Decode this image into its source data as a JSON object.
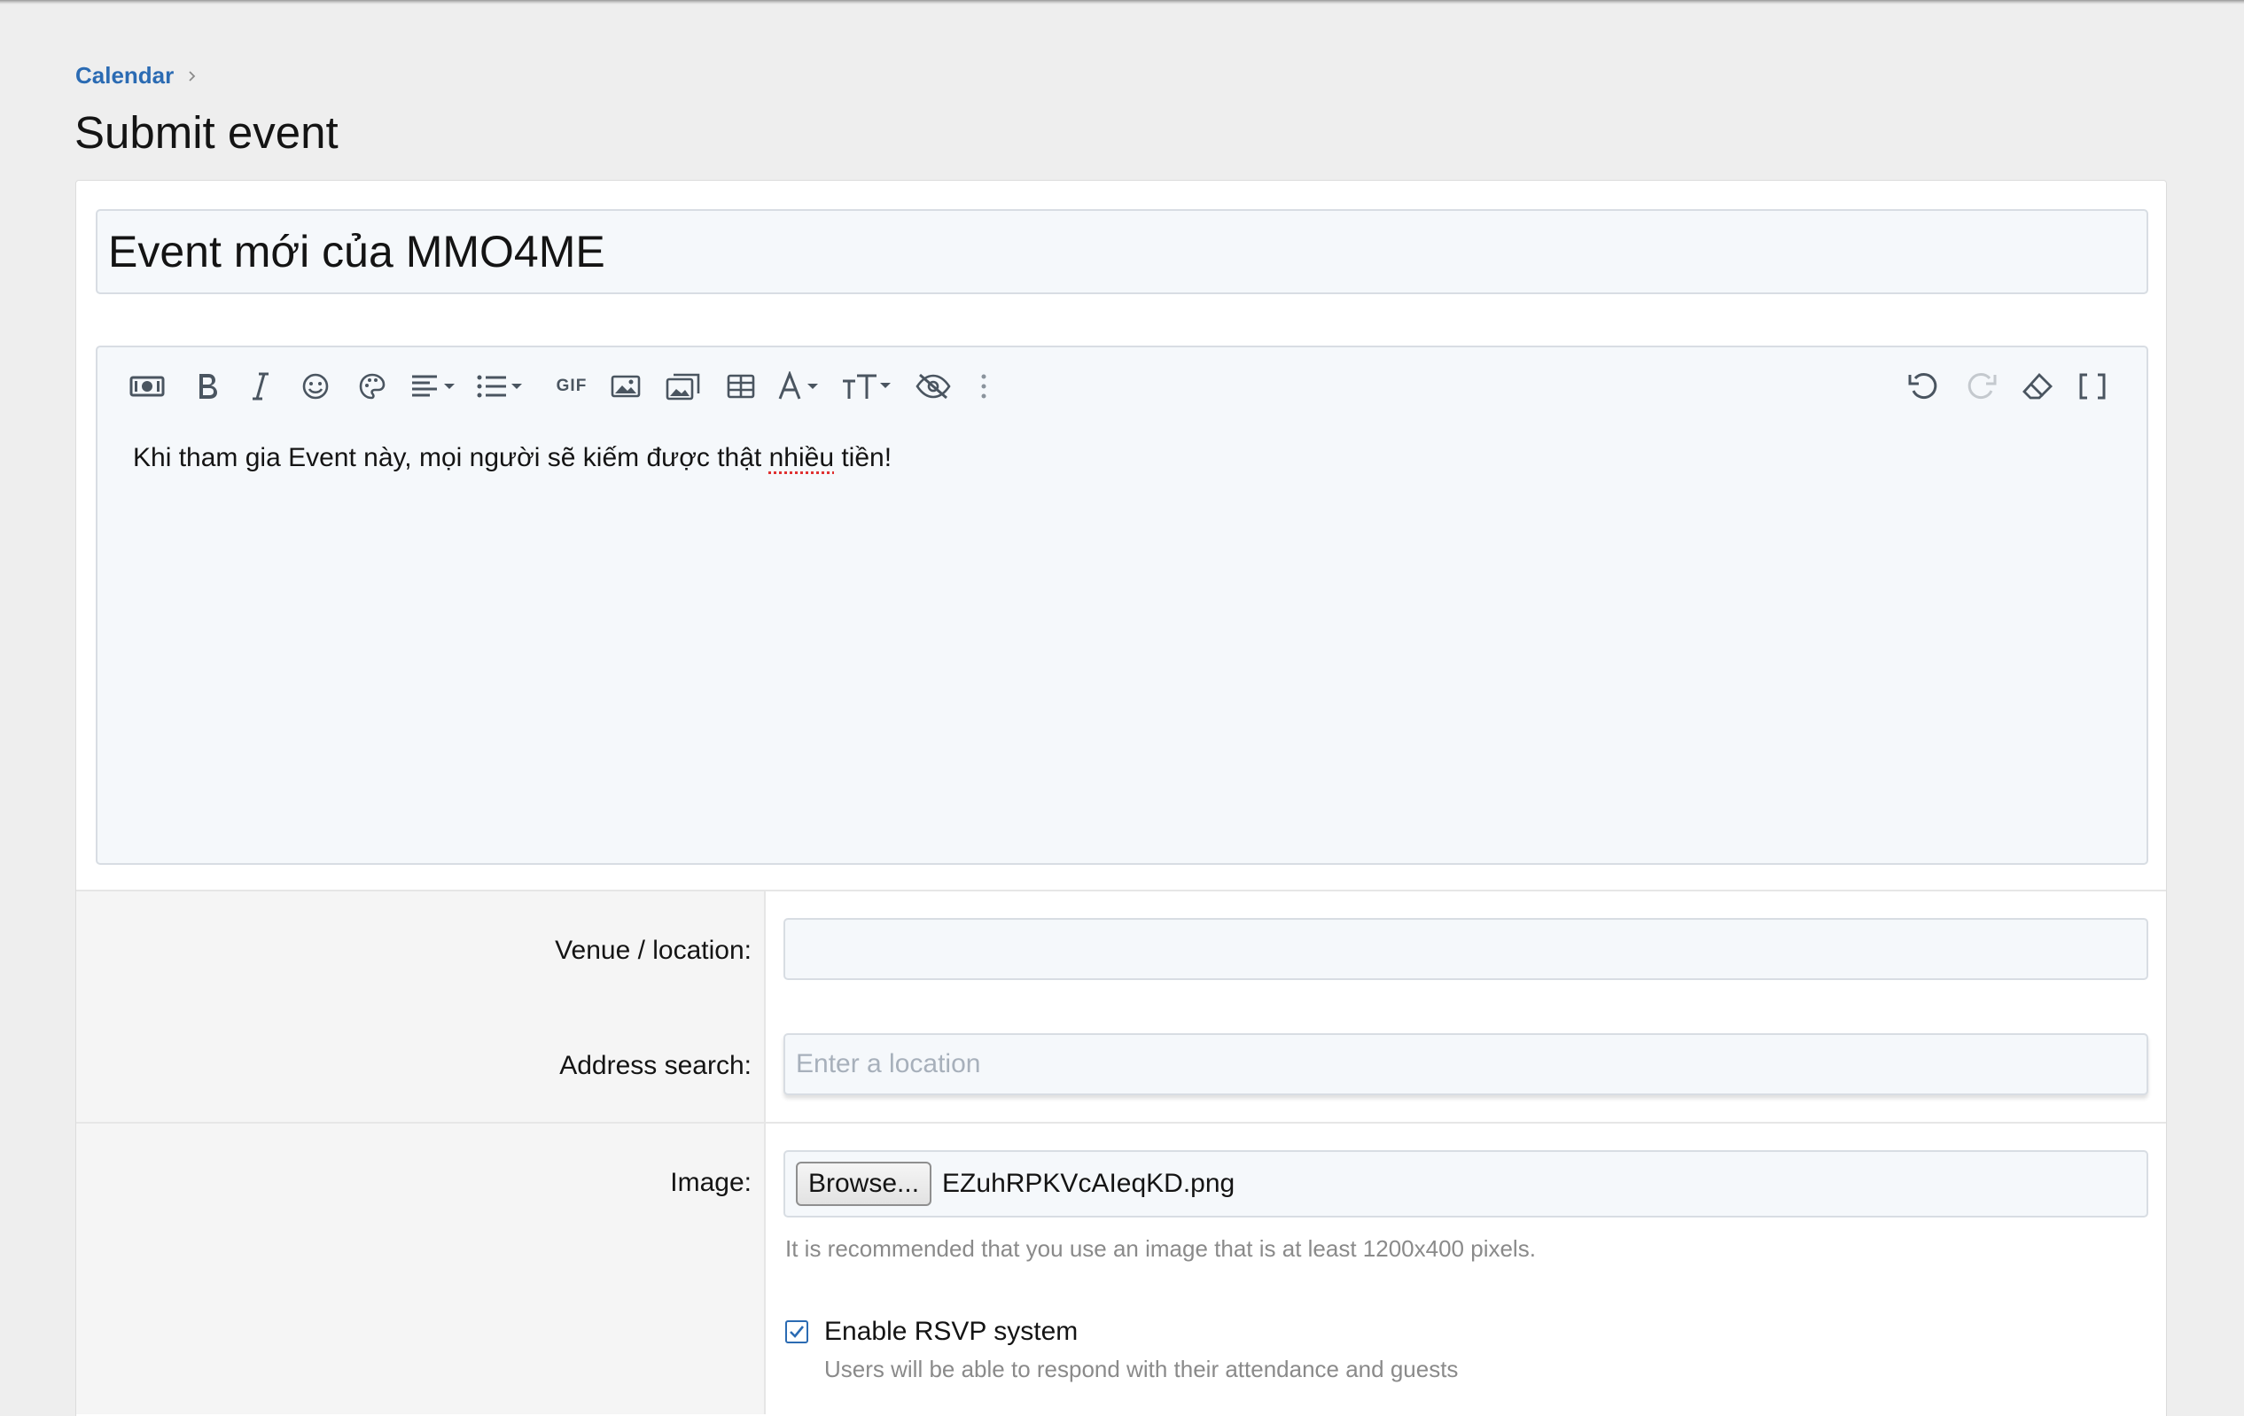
{
  "breadcrumb": {
    "parent": "Calendar"
  },
  "page_title": "Submit event",
  "event_title": {
    "value": "Event mới của MMO4ME"
  },
  "editor": {
    "toolbar_icons": [
      "money-icon",
      "bold-icon",
      "italic-icon",
      "smiley-icon",
      "palette-icon",
      "align-icon",
      "list-icon",
      "gif-icon",
      "image-icon",
      "media-icon",
      "table-icon",
      "font-icon",
      "text-size-icon",
      "hide-icon",
      "more-icon",
      "undo-icon",
      "redo-icon",
      "eraser-icon",
      "brackets-icon"
    ],
    "gif_label": "GIF",
    "content_before": "Khi tham gia Event này, mọi người sẽ kiếm được thật ",
    "content_misspelled": "nhiều",
    "content_after": " tiền!"
  },
  "venue": {
    "label": "Venue / location:",
    "value": ""
  },
  "address": {
    "label": "Address search:",
    "placeholder": "Enter a location"
  },
  "image": {
    "label": "Image:",
    "browse_label": "Browse...",
    "file_name": "EZuhRPKVcAIeqKD.png",
    "hint": "It is recommended that you use an image that is at least 1200x400 pixels."
  },
  "rsvp": {
    "checked": true,
    "label": "Enable RSVP system",
    "description": "Users will be able to respond with their attendance and guests"
  },
  "colors": {
    "link": "#2b6bb3",
    "field_bg": "#f5f8fb",
    "page_bg": "#eeeeee"
  }
}
